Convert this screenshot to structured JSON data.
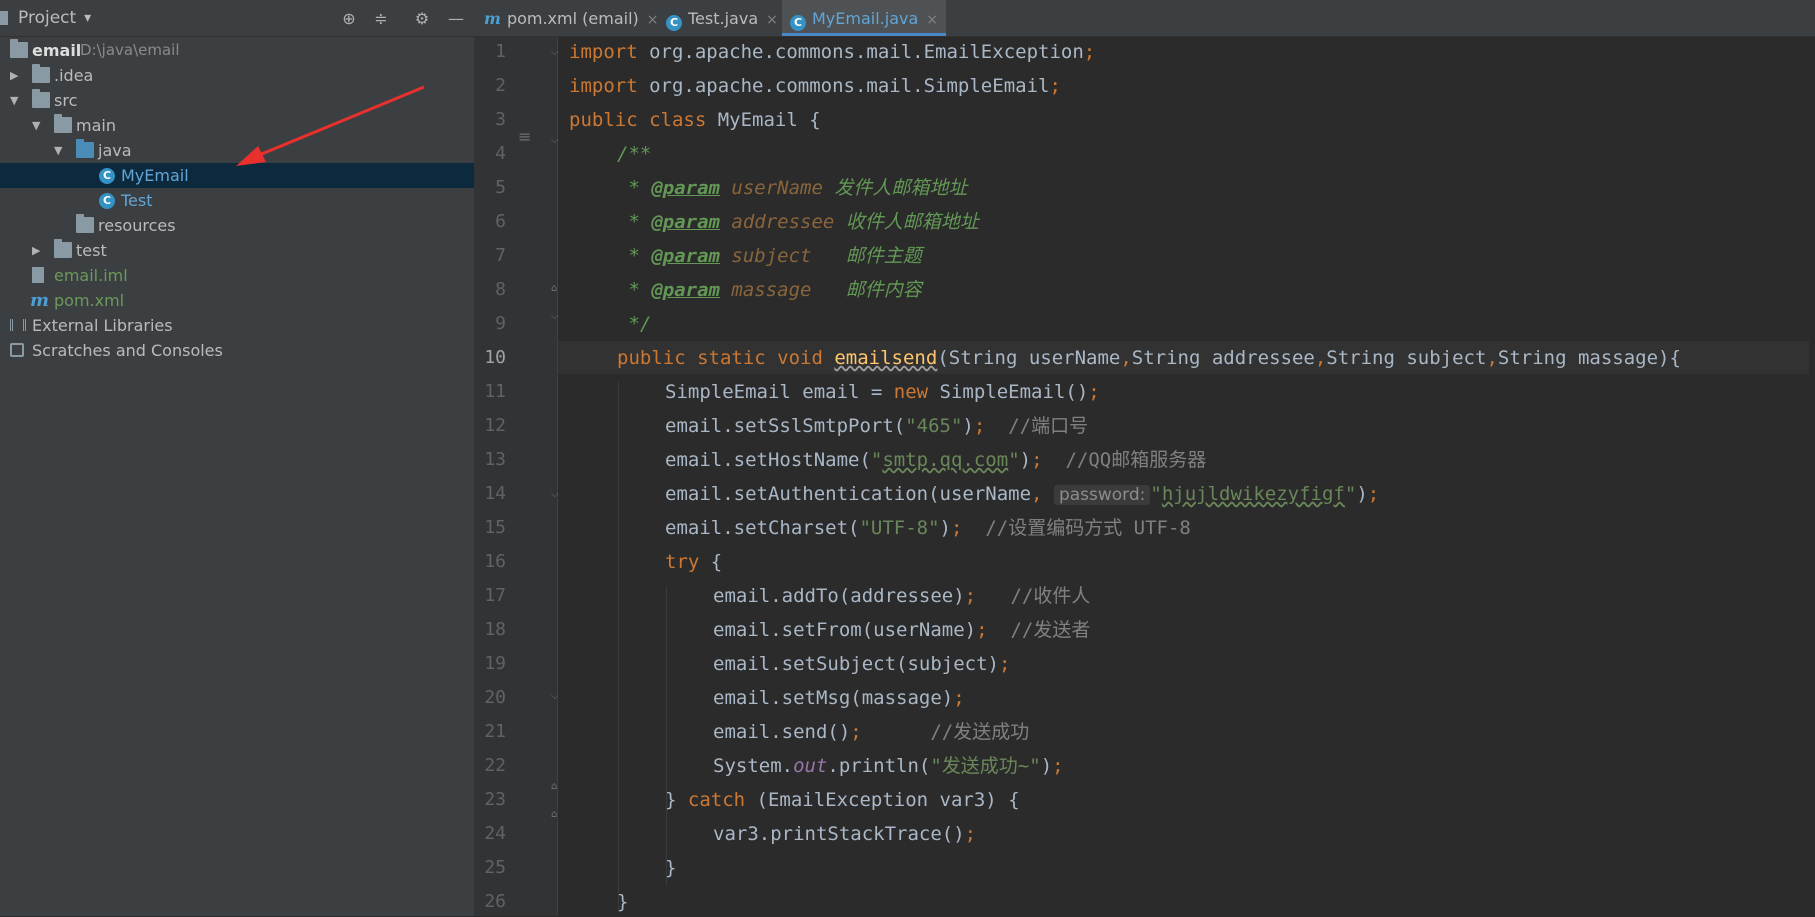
{
  "window": {
    "panel_title": "Project",
    "panel_title_dropdown": "▾"
  },
  "tree": {
    "root_label": "email",
    "root_path": "D:\\java\\email",
    "idea": ".idea",
    "src": "src",
    "main": "main",
    "java": "java",
    "myemail": "MyEmail",
    "test_class": "Test",
    "resources": "resources",
    "test_dir": "test",
    "email_iml": "email.iml",
    "pom": "pom.xml",
    "ext_libs": "External Libraries",
    "scratches": "Scratches and Consoles"
  },
  "tabs": [
    {
      "label": "pom.xml (email)",
      "icon": "m"
    },
    {
      "label": "Test.java",
      "icon": "c"
    },
    {
      "label": "MyEmail.java",
      "icon": "c"
    }
  ],
  "tab_close": "×",
  "editor": {
    "current_line": 10,
    "line_numbers": [
      "1",
      "2",
      "3",
      "4",
      "5",
      "6",
      "7",
      "8",
      "9",
      "10",
      "11",
      "12",
      "13",
      "14",
      "15",
      "16",
      "17",
      "18",
      "19",
      "20",
      "21",
      "22",
      "23",
      "24",
      "25",
      "26"
    ],
    "code": {
      "l1_kw": "import",
      "l1_pkg": " org.apache.commons.mail.EmailException",
      "l1_end": ";",
      "l2_kw": "import",
      "l2_pkg": " org.apache.commons.mail.SimpleEmail",
      "l2_end": ";",
      "l3_kw": "public class",
      "l3_rest": " MyEmail {",
      "l4": "/**",
      "l5_star": " * ",
      "l5_tag": "@param",
      "l5_name": " userName",
      "l5_desc": " 发件人邮箱地址",
      "l6_star": " * ",
      "l6_tag": "@param",
      "l6_name": " addressee",
      "l6_desc": " 收件人邮箱地址",
      "l7_star": " * ",
      "l7_tag": "@param",
      "l7_name": " subject",
      "l7_desc": "   邮件主题",
      "l8_star": " * ",
      "l8_tag": "@param",
      "l8_name": " massage",
      "l8_desc": "   邮件内容",
      "l9": " */",
      "l10_kw": "public static void",
      "l10_fn": "emailsend",
      "l10_a": "(String userName",
      "l10_c1": ",",
      "l10_b": "String addressee",
      "l10_c2": ",",
      "l10_c": "String subject",
      "l10_c3": ",",
      "l10_d": "String massage){",
      "l11_a": "SimpleEmail email = ",
      "l11_kw": "new",
      "l11_b": " SimpleEmail()",
      "l11_end": ";",
      "l12_a": "email.setSslSmtpPort(",
      "l12_str": "\"465\"",
      "l12_b": ")",
      "l12_end": ";",
      "l12_cmt": "  //端口号",
      "l13_a": "email.setHostName(",
      "l13_q1": "\"",
      "l13_str": "smtp.qq.com",
      "l13_q2": "\"",
      "l13_b": ")",
      "l13_end": ";",
      "l13_cmt": "  //QQ邮箱服务器",
      "l14_a": "email.setAuthentication(userName",
      "l14_c": ",",
      "l14_hint": "password:",
      "l14_q1": "\"",
      "l14_str": "hjujldwikezyfigf",
      "l14_q2": "\"",
      "l14_b": ")",
      "l14_end": ";",
      "l15_a": "email.setCharset(",
      "l15_str": "\"UTF-8\"",
      "l15_b": ")",
      "l15_end": ";",
      "l15_cmt": "  //设置编码方式 UTF-8",
      "l16_kw": "try",
      "l16_b": " {",
      "l17_a": "email.addTo(addressee)",
      "l17_end": ";",
      "l17_cmt": "   //收件人",
      "l18_a": "email.setFrom(userName)",
      "l18_end": ";",
      "l18_cmt": "  //发送者",
      "l19_a": "email.setSubject(subject)",
      "l19_end": ";",
      "l20_a": "email.setMsg(massage)",
      "l20_end": ";",
      "l21_a": "email.send()",
      "l21_end": ";",
      "l21_cmt": "      //发送成功",
      "l22_a": "System.",
      "l22_out": "out",
      "l22_b": ".println(",
      "l22_str": "\"发送成功~\"",
      "l22_c": ")",
      "l22_end": ";",
      "l23_a": "} ",
      "l23_kw": "catch",
      "l23_b": " (EmailException var3) {",
      "l24_a": "var3.printStackTrace()",
      "l24_end": ";",
      "l25": "}",
      "l26": "}"
    }
  },
  "colors": {
    "keyword": "#cc7832",
    "string": "#6a8759",
    "comment": "#808080",
    "doc": "#629755",
    "function": "#ffc66d",
    "selection": "#0d293e",
    "accent": "#4a88c7"
  }
}
